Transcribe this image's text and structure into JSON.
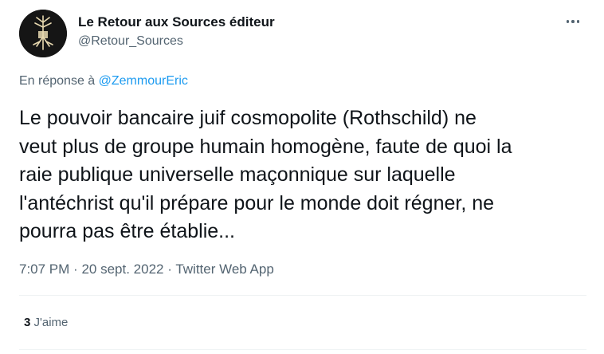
{
  "author": {
    "name": "Le Retour aux Sources éditeur",
    "handle": "@Retour_Sources",
    "avatar_icon": "tree-roots-icon"
  },
  "reply": {
    "prefix": "En réponse à",
    "mention": "@ZemmourEric"
  },
  "tweet": {
    "text": "Le pouvoir bancaire juif cosmopolite (Rothschild) ne\nveut plus de groupe humain homogène, faute de quoi la\nraie publique universelle maçonnique sur laquelle\nl'antéchrist qu'il prépare pour le monde doit régner, ne\npourra pas être établie..."
  },
  "meta": {
    "time": "7:07 PM",
    "separator": "·",
    "date": "20 sept. 2022",
    "source": "Twitter Web App"
  },
  "stats": {
    "likes_count": "3",
    "likes_label": "J'aime"
  },
  "colors": {
    "text": "#0f1419",
    "secondary": "#536471",
    "link": "#1d9bf0",
    "divider": "#eff3f4"
  }
}
